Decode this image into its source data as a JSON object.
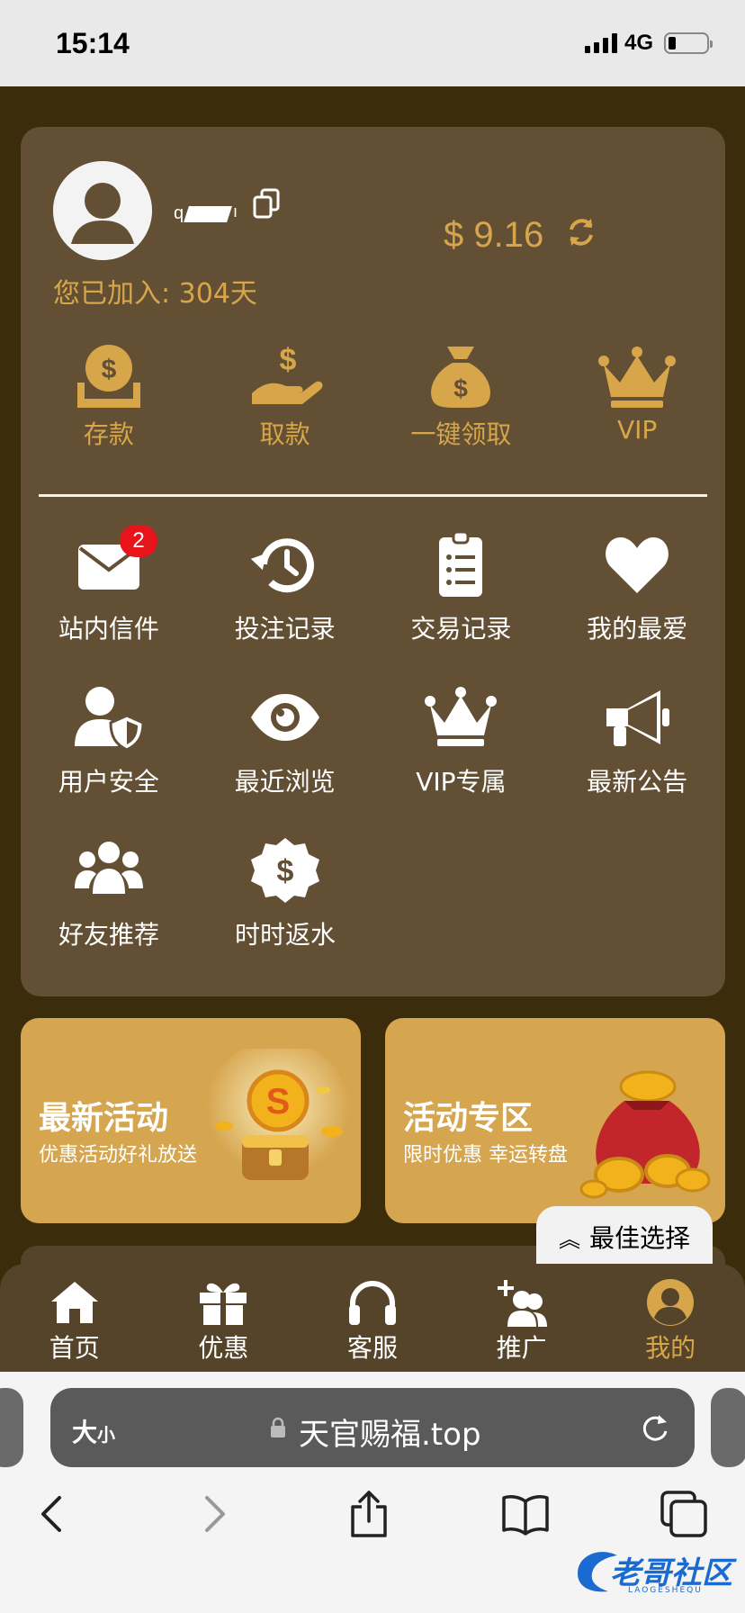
{
  "status_bar": {
    "time": "15:14",
    "network": "4G"
  },
  "profile": {
    "joined_text": "您已加入: 304天",
    "balance": "$ 9.16"
  },
  "quick_actions": [
    {
      "label": "存款",
      "icon": "money-box-icon"
    },
    {
      "label": "取款",
      "icon": "hand-money-icon"
    },
    {
      "label": "一键领取",
      "icon": "money-bag-icon"
    },
    {
      "label": "VIP",
      "icon": "crown-icon"
    }
  ],
  "menu": [
    {
      "label": "站内信件",
      "icon": "envelope-icon",
      "badge": "2"
    },
    {
      "label": "投注记录",
      "icon": "history-icon"
    },
    {
      "label": "交易记录",
      "icon": "clipboard-list-icon"
    },
    {
      "label": "我的最爱",
      "icon": "heart-icon"
    },
    {
      "label": "用户安全",
      "icon": "user-shield-icon"
    },
    {
      "label": "最近浏览",
      "icon": "eye-icon"
    },
    {
      "label": "VIP专属",
      "icon": "crown-icon"
    },
    {
      "label": "最新公告",
      "icon": "megaphone-icon"
    },
    {
      "label": "好友推荐",
      "icon": "users-icon"
    },
    {
      "label": "时时返水",
      "icon": "dollar-badge-icon"
    }
  ],
  "promo_cards": [
    {
      "title": "最新活动",
      "subtitle": "优惠活动好礼放送"
    },
    {
      "title": "活动专区",
      "subtitle": "限时优惠 幸运转盘"
    }
  ],
  "best_choice": {
    "label": "最佳选择"
  },
  "tabbar": [
    {
      "label": "首页",
      "icon": "home-icon"
    },
    {
      "label": "优惠",
      "icon": "gift-icon"
    },
    {
      "label": "客服",
      "icon": "headphones-icon"
    },
    {
      "label": "推广",
      "icon": "user-plus-icon"
    },
    {
      "label": "我的",
      "icon": "user-circle-icon",
      "active": true
    }
  ],
  "browser": {
    "text_size_label": "大",
    "text_size_small": "小",
    "url": "天官赐福.top"
  },
  "watermark": {
    "text": "老哥社区",
    "sub": "LAOGESHEQU"
  },
  "colors": {
    "accent": "#d7a64b",
    "panel": "#635034",
    "background": "#3b2d0b"
  }
}
